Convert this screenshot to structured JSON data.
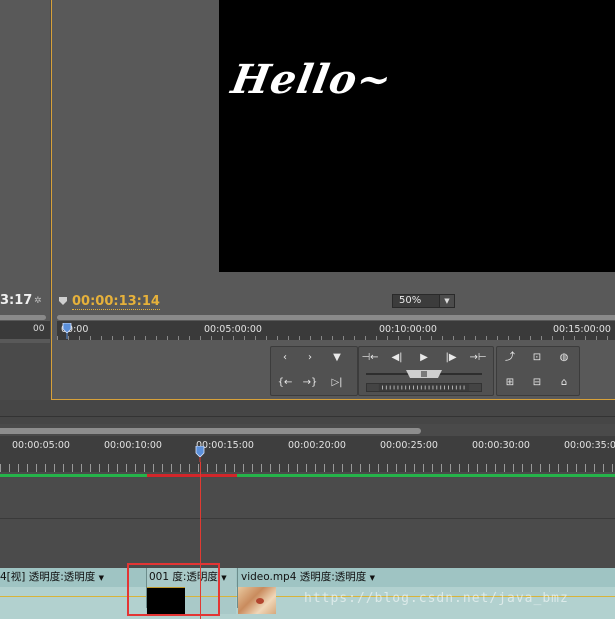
{
  "source_monitor": {
    "timecode": "3:17",
    "ruler_label": "00"
  },
  "program_monitor": {
    "preview_text": "Hello~",
    "timecode": "00:00:13:14",
    "zoom": "50%",
    "ruler_labels": [
      "00:00",
      "00:05:00:00",
      "00:10:00:00",
      "00:15:00:00"
    ]
  },
  "transport": {
    "row1": [
      "‹",
      "›",
      "▼",
      "⊣←",
      "◀|",
      "▶",
      "|▶",
      "→⊢",
      "⤴",
      "⊡",
      "◍"
    ],
    "row2": [
      "{←",
      "→}",
      "▷|",
      "⊞",
      "⊟",
      "⌂"
    ]
  },
  "timeline": {
    "ruler_labels": [
      "00:00:05:00",
      "00:00:10:00",
      "00:00:15:00",
      "00:00:20:00",
      "00:00:25:00",
      "00:00:30:00",
      "00:00:35:0"
    ],
    "clips": [
      {
        "header": "4[视]  透明度:透明度"
      },
      {
        "header": "001  度:透明度"
      },
      {
        "header": "video.mp4  透明度:透明度"
      }
    ]
  },
  "watermark": "https://blog.csdn.net/java_bmz",
  "colors": {
    "timecode": "#e6b13b",
    "panel_border": "#d7a13a",
    "work_area": "#25b34a",
    "render_bar": "#d2262a",
    "highlight": "#e33534"
  }
}
